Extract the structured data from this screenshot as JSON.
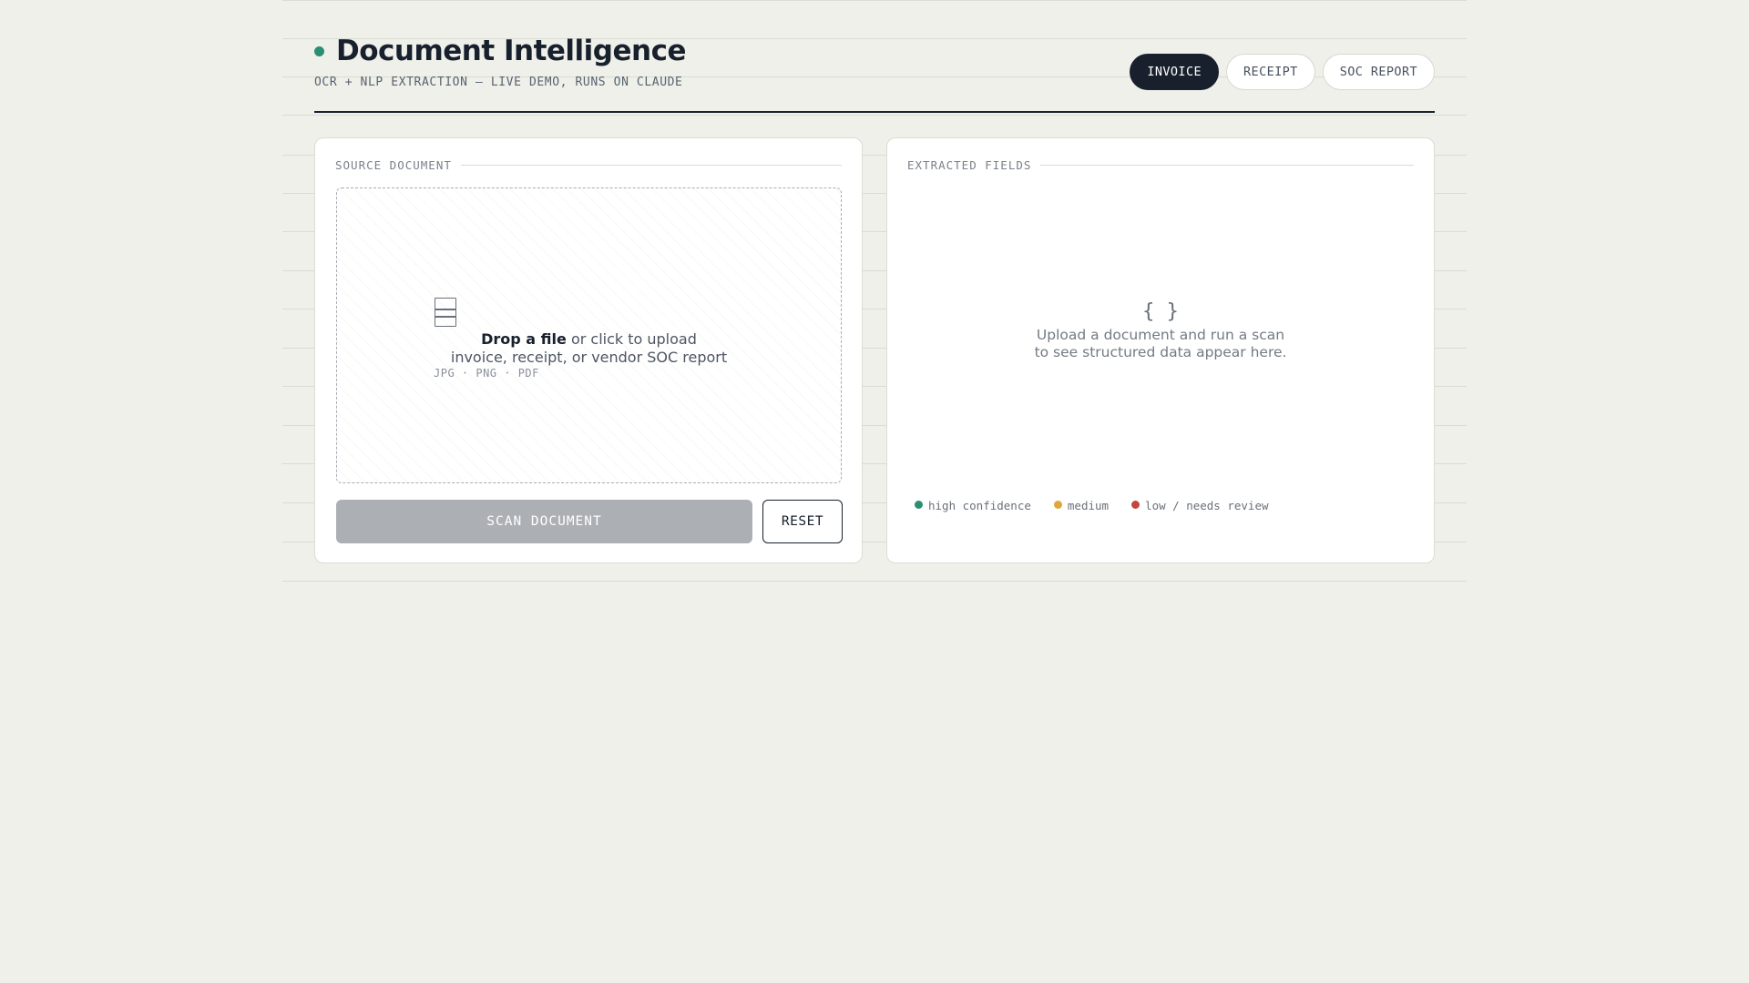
{
  "app": {
    "title": "Document Intelligence",
    "subtitle": "OCR + NLP EXTRACTION — LIVE DEMO, RUNS ON CLAUDE"
  },
  "doc_types": [
    {
      "label": "INVOICE",
      "active": true
    },
    {
      "label": "RECEIPT",
      "active": false
    },
    {
      "label": "SOC REPORT",
      "active": false
    }
  ],
  "source_panel": {
    "label": "SOURCE DOCUMENT",
    "dropzone": {
      "primary_strong": "Drop a file",
      "primary_rest": " or click to upload",
      "secondary": "invoice, receipt, or vendor SOC report",
      "formats": "JPG · PNG · PDF",
      "icon": "document-icon"
    },
    "scan_label": "SCAN DOCUMENT",
    "reset_label": "RESET"
  },
  "fields_panel": {
    "label": "EXTRACTED FIELDS",
    "empty_icon": "braces-icon",
    "empty_icon_glyph": "{ }",
    "empty_line1": "Upload a document and run a scan",
    "empty_line2": "to see structured data appear here.",
    "legend": [
      {
        "label": "high confidence",
        "color": "#2a8f72"
      },
      {
        "label": "medium",
        "color": "#e0a83a"
      },
      {
        "label": "low / needs review",
        "color": "#c2463e"
      }
    ]
  },
  "colors": {
    "accent": "#2a8f72",
    "ink": "#17202c",
    "background": "#eef0e9",
    "disabled_button": "#acb0b5"
  }
}
